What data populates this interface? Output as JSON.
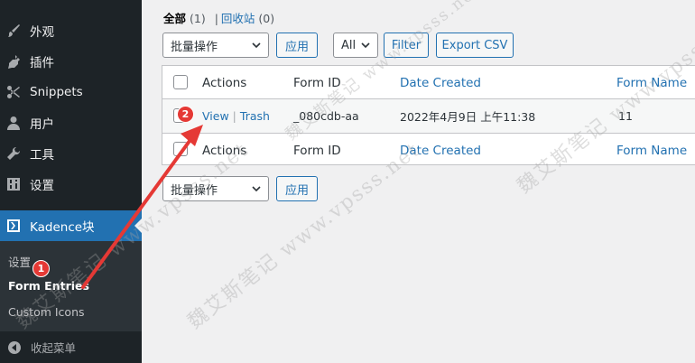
{
  "sidebar": {
    "items": [
      {
        "label": "外观",
        "icon": "paintbrush-icon"
      },
      {
        "label": "插件",
        "icon": "plugin-icon"
      },
      {
        "label": "Snippets",
        "icon": "scissors-icon"
      },
      {
        "label": "用户",
        "icon": "user-icon"
      },
      {
        "label": "工具",
        "icon": "wrench-icon"
      },
      {
        "label": "设置",
        "icon": "settings-sliders-icon"
      },
      {
        "label": "Kadence块",
        "icon": "kadence-icon"
      }
    ],
    "submenu": [
      "设置",
      "Form Entries",
      "Custom Icons"
    ],
    "collapse_label": "收起菜单"
  },
  "views": {
    "all_label": "全部",
    "all_count": "(1)",
    "trash_label": "回收站",
    "trash_count": "(0)",
    "separator": "|"
  },
  "toolbar": {
    "bulk_action": "批量操作",
    "apply": "应用",
    "filter_select": "All",
    "filter": "Filter",
    "export": "Export CSV"
  },
  "table": {
    "columns": [
      "Actions",
      "Form ID",
      "Date Created",
      "Form Name"
    ],
    "rows": [
      {
        "view": "View",
        "sep": "|",
        "trash": "Trash",
        "form_id": "_080cdb-aa",
        "date": "2022年4月9日 上午11:38",
        "form_name": "11"
      }
    ]
  },
  "annotations": [
    "1",
    "2"
  ],
  "watermark": "魏艾斯笔记 www.vpsss.net",
  "colors": {
    "sidebar_bg": "#1d2327",
    "accent": "#2271b1",
    "annotation": "#e53935"
  }
}
